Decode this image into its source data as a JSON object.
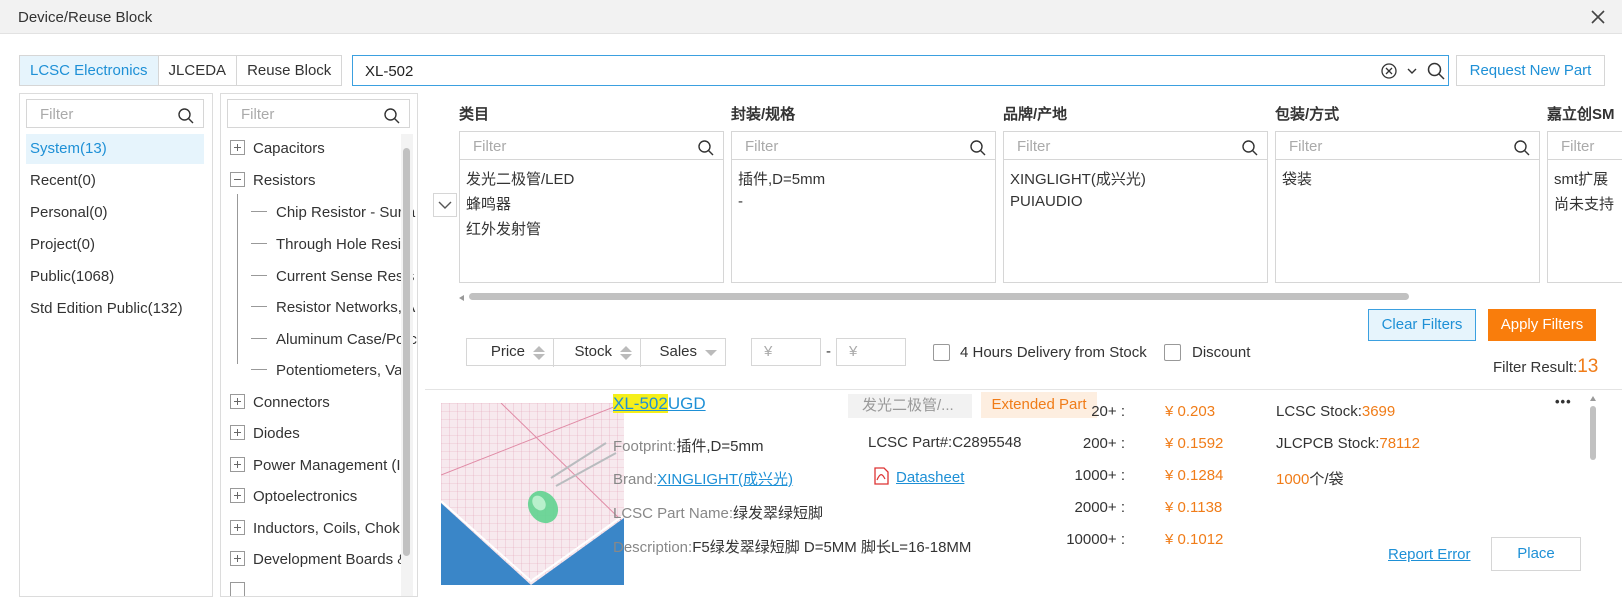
{
  "window": {
    "title": "Device/Reuse Block"
  },
  "tabs": [
    "LCSC Electronics",
    "JLCEDA",
    "Reuse Block"
  ],
  "search": {
    "value": "XL-502"
  },
  "request_new_part": "Request New Part",
  "filter_placeholder": "Filter",
  "libraries": [
    "System(13)",
    "Recent(0)",
    "Personal(0)",
    "Project(0)",
    "Public(1068)",
    "Std Edition Public(132)"
  ],
  "categories": {
    "top": [
      "Capacitors",
      "Resistors"
    ],
    "resistor_children": [
      "Chip Resistor - Surfa",
      "Through Hole Resist",
      "Current Sense Resis",
      "Resistor Networks, A",
      "Aluminum Case/Porc",
      "Potentiometers, Vari"
    ],
    "bottom": [
      "Connectors",
      "Diodes",
      "Power Management (I",
      "Optoelectronics",
      "Inductors, Coils, Chok",
      "Development Boards &"
    ]
  },
  "facets": [
    {
      "title": "类目",
      "options": [
        "发光二极管/LED",
        "蜂鸣器",
        "红外发射管"
      ]
    },
    {
      "title": "封装/规格",
      "options": [
        "插件,D=5mm",
        "-"
      ]
    },
    {
      "title": "品牌/产地",
      "options": [
        "XINGLIGHT(成兴光)",
        "PUIAUDIO"
      ]
    },
    {
      "title": "包装/方式",
      "options": [
        "袋装"
      ]
    },
    {
      "title": "嘉立创SM",
      "options": [
        "smt扩展",
        "尚未支持"
      ]
    }
  ],
  "buttons": {
    "clear_filters": "Clear Filters",
    "apply_filters": "Apply Filters"
  },
  "sort": [
    "Price",
    "Stock",
    "Sales"
  ],
  "price_range": {
    "min_placeholder": "¥",
    "max_placeholder": "¥",
    "separator": "-"
  },
  "options": {
    "four_hours": "4 Hours Delivery from Stock",
    "discount": "Discount"
  },
  "filter_result": {
    "label": "Filter Result:",
    "count": "13"
  },
  "result": {
    "name_highlight": "XL-502",
    "name_rest": "UGD",
    "category_tag": "发光二极管/...",
    "extended_tag": "Extended Part",
    "footprint_label": "Footprint:",
    "footprint": "插件,D=5mm",
    "brand_label": "Brand:",
    "brand": "XINGLIGHT(成兴光)",
    "part_name_label": "LCSC Part Name:",
    "part_name": "绿发翠绿短脚",
    "description_label": "Description:",
    "description": "F5绿发翠绿短脚 D=5MM 脚长L=16-18MM",
    "lcsc_part": "LCSC Part#:C2895548",
    "datasheet": "Datasheet",
    "prices": [
      {
        "qty": "20+ :",
        "price": "¥ 0.203"
      },
      {
        "qty": "200+ :",
        "price": "¥ 0.1592"
      },
      {
        "qty": "1000+ :",
        "price": "¥ 0.1284"
      },
      {
        "qty": "2000+ :",
        "price": "¥ 0.1138"
      },
      {
        "qty": "10000+ :",
        "price": "¥ 0.1012"
      }
    ],
    "lcsc_stock_label": "LCSC Stock:",
    "lcsc_stock": "3699",
    "jlcpcb_stock_label": "JLCPCB Stock:",
    "jlcpcb_stock": "78112",
    "pack_qty": "1000",
    "pack_unit": "个/袋",
    "more": "•••",
    "report_error": "Report Error",
    "place": "Place"
  },
  "colors": {
    "accent": "#1e90d6",
    "orange": "#f07c18",
    "highlight": "#f5ef1a"
  }
}
